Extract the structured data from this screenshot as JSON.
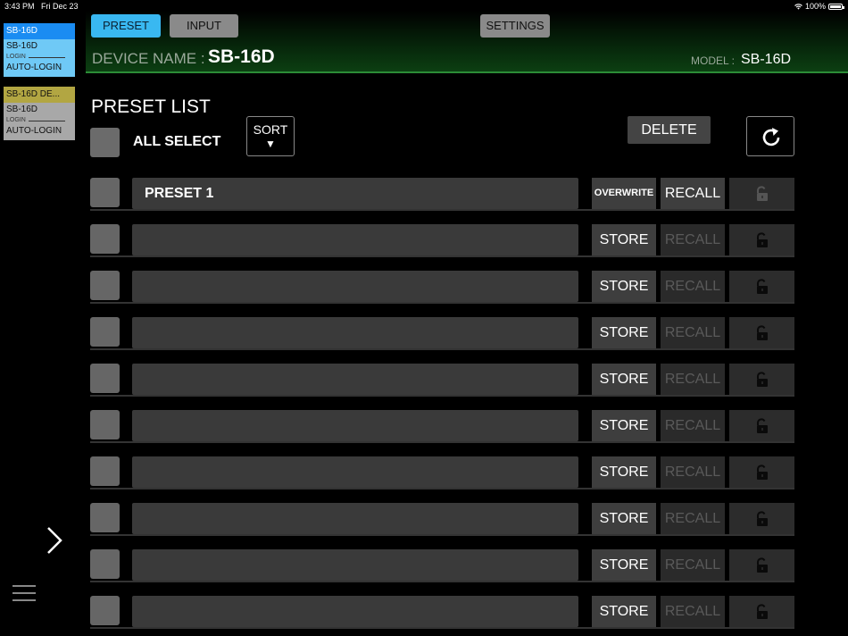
{
  "status_bar": {
    "time": "3:43 PM",
    "date": "Fri Dec 23",
    "battery": "100%"
  },
  "devices": [
    {
      "name": "SB-16D",
      "model": "SB-16D",
      "login": "LOGIN",
      "auto_login": "AUTO-LOGIN",
      "color": "#1a8cf2"
    },
    {
      "name": "SB-16D DE...",
      "model": "SB-16D",
      "login": "LOGIN",
      "auto_login": "AUTO-LOGIN",
      "color": "#b2a642"
    }
  ],
  "header": {
    "tabs": {
      "preset": "PRESET",
      "input": "INPUT",
      "settings": "SETTINGS"
    },
    "device_name_label": "DEVICE NAME :",
    "device_name": "SB-16D",
    "model_label": "MODEL :",
    "model": "SB-16D"
  },
  "preset_list": {
    "title": "PRESET LIST",
    "all_select": "ALL SELECT",
    "sort": "SORT",
    "sort_arrow": "▼",
    "delete": "DELETE",
    "rows": [
      {
        "name": "PRESET 1",
        "store": "OVERWRITE",
        "recall": "RECALL",
        "recall_enabled": true
      },
      {
        "name": "",
        "store": "STORE",
        "recall": "RECALL",
        "recall_enabled": false
      },
      {
        "name": "",
        "store": "STORE",
        "recall": "RECALL",
        "recall_enabled": false
      },
      {
        "name": "",
        "store": "STORE",
        "recall": "RECALL",
        "recall_enabled": false
      },
      {
        "name": "",
        "store": "STORE",
        "recall": "RECALL",
        "recall_enabled": false
      },
      {
        "name": "",
        "store": "STORE",
        "recall": "RECALL",
        "recall_enabled": false
      },
      {
        "name": "",
        "store": "STORE",
        "recall": "RECALL",
        "recall_enabled": false
      },
      {
        "name": "",
        "store": "STORE",
        "recall": "RECALL",
        "recall_enabled": false
      },
      {
        "name": "",
        "store": "STORE",
        "recall": "RECALL",
        "recall_enabled": false
      },
      {
        "name": "",
        "store": "STORE",
        "recall": "RECALL",
        "recall_enabled": false
      }
    ]
  },
  "icons": [
    "wifi-icon",
    "battery-icon",
    "chevron-right-icon",
    "menu-icon",
    "refresh-icon",
    "lock-icon"
  ]
}
